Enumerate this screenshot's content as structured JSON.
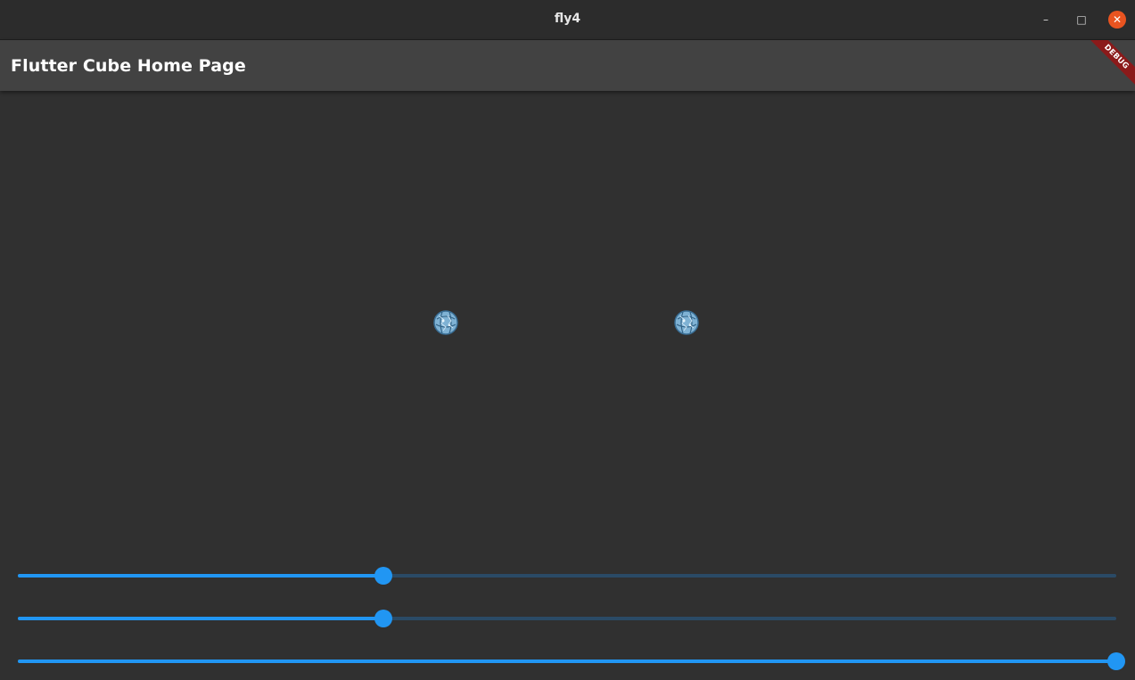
{
  "window": {
    "title": "fly4",
    "controls": {
      "minimize": "–",
      "maximize": "□",
      "close": "✕"
    }
  },
  "appbar": {
    "title": "Flutter Cube Home Page",
    "debug_banner": "DEBUG"
  },
  "scene": {
    "objects": [
      {
        "icon": "sphere-icon"
      },
      {
        "icon": "sphere-icon"
      }
    ]
  },
  "sliders": [
    {
      "value": 0.333
    },
    {
      "value": 0.333
    },
    {
      "value": 1.0
    }
  ],
  "colors": {
    "accent": "#2196f3",
    "inactive_track": "#2a4a66",
    "background": "#303030",
    "appbar": "#424242",
    "close_button": "#e95420",
    "debug_banner": "#8b1a1a"
  }
}
